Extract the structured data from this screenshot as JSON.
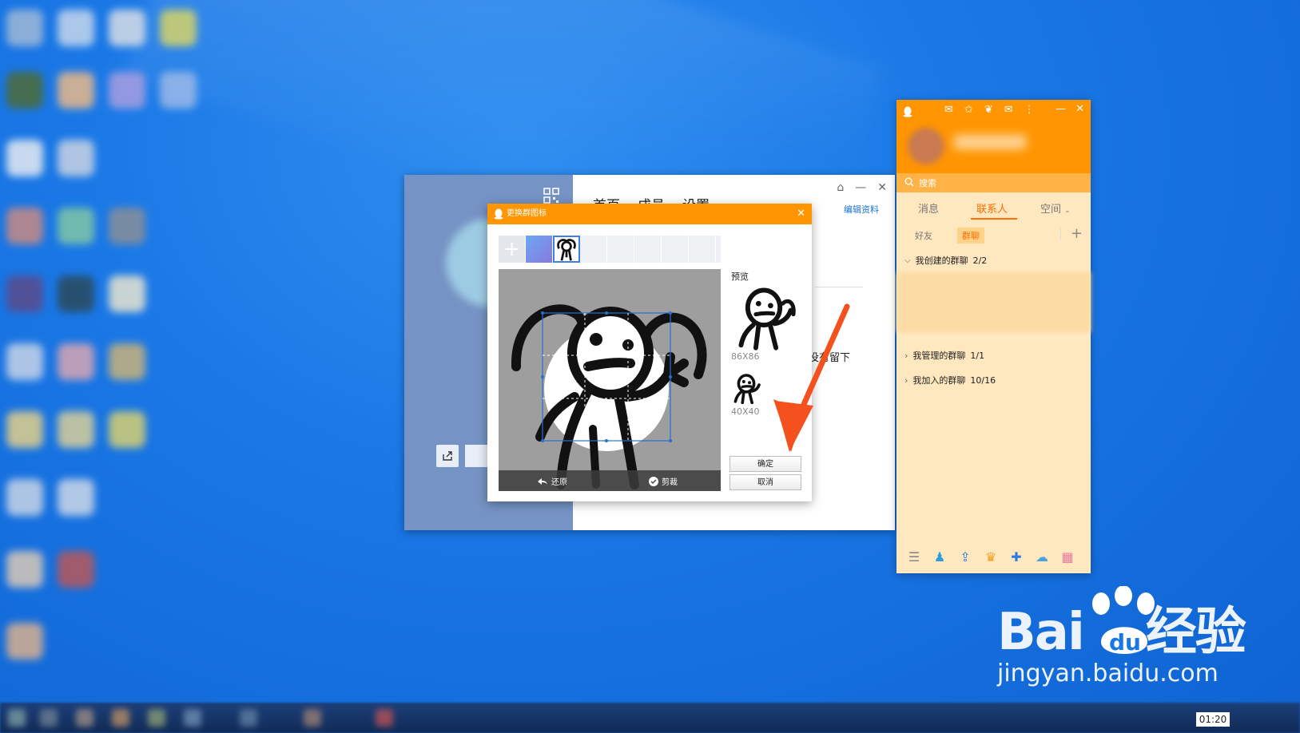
{
  "group_window": {
    "tabs": [
      "首页",
      "成员",
      "设置"
    ],
    "edit_profile": "编辑资料",
    "partial_text": "没有留下"
  },
  "dialog": {
    "title": "更换群图标",
    "close": "✕",
    "undo_label": "还原",
    "crop_label": "剪裁",
    "preview_label": "预览",
    "size_large": "86X86",
    "size_small": "40X40",
    "confirm": "确定",
    "cancel": "取消"
  },
  "qq_panel": {
    "search_placeholder": "搜索",
    "tabs": [
      "消息",
      "联系人",
      "空间"
    ],
    "active_tab": "联系人",
    "subtabs": [
      "好友",
      "群聊"
    ],
    "active_subtab": "群聊",
    "groups": [
      {
        "label": "我创建的群聊",
        "count": "2/2",
        "expanded": true
      },
      {
        "label": "我管理的群聊",
        "count": "1/1",
        "expanded": false
      },
      {
        "label": "我加入的群聊",
        "count": "10/16",
        "expanded": false
      }
    ]
  },
  "taskbar": {
    "clock": "01:20"
  },
  "watermark": {
    "brand_text": "Bai",
    "brand_suffix": "经验",
    "url": "jingyan.baidu.com"
  },
  "colors": {
    "accent_orange": "#ff9500",
    "panel_bg": "#ffe7bf",
    "arrow": "#f4511e"
  }
}
